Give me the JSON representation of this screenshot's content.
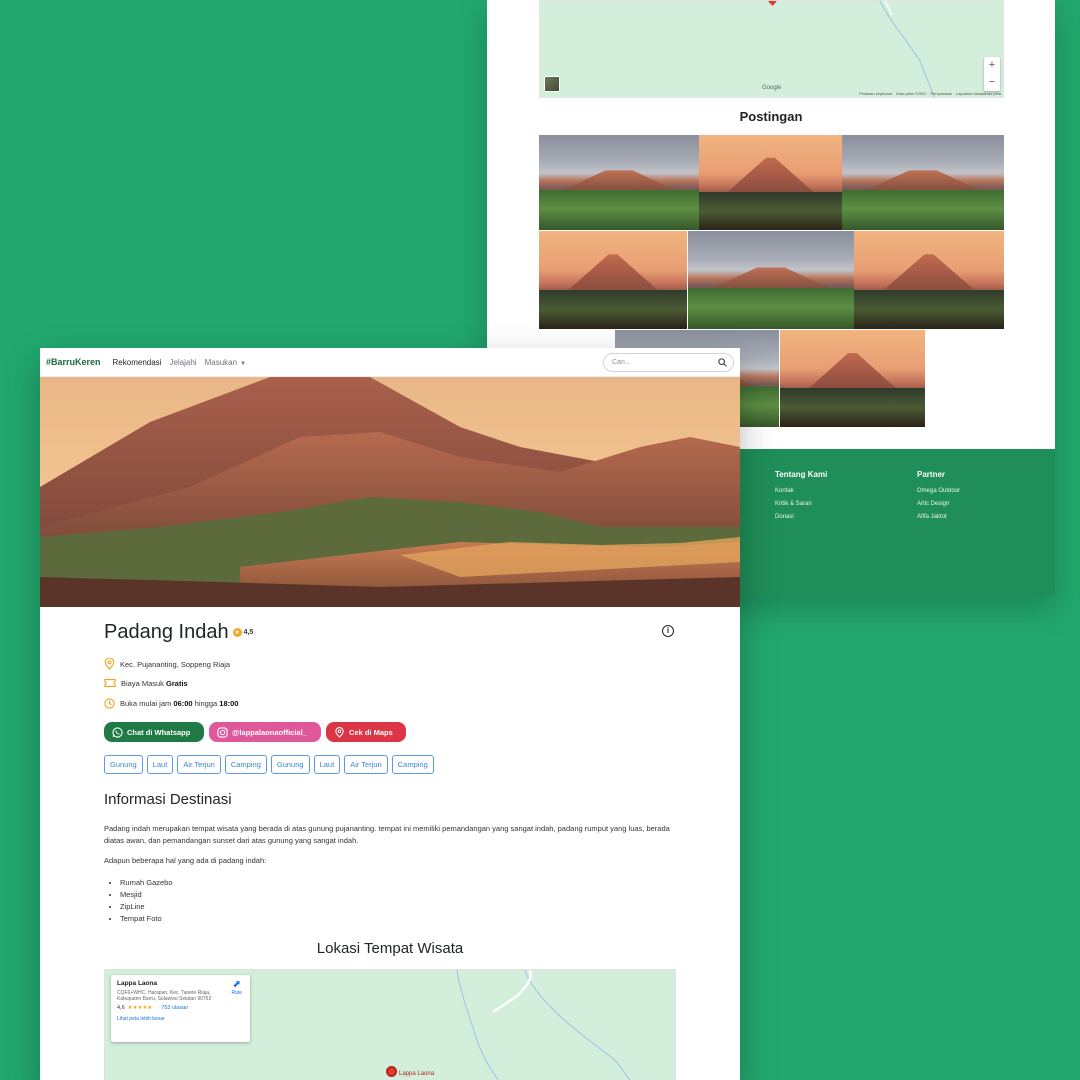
{
  "back": {
    "map": {
      "zoom_in": "+",
      "zoom_out": "−",
      "google": "Google",
      "attribution": [
        "Pintasan keyboard",
        "Data peta ©2022",
        "Persyaratan",
        "Laporkan kesalahan peta"
      ]
    },
    "posts_title": "Postingan",
    "footer": {
      "about_title": "Tentang Kami",
      "about_links": [
        "Kontak",
        "Kritik & Saran",
        "Donasi"
      ],
      "partner_title": "Partner",
      "partner_links": [
        "Omega Outdoor",
        "Artic Design",
        "Afifa Jaktot"
      ]
    }
  },
  "nav": {
    "brand": "#BarruKeren",
    "links": [
      "Rekomendasi",
      "Jelajahi",
      "Masukan"
    ],
    "search_placeholder": "Cari..."
  },
  "place": {
    "name": "Padang Indah",
    "rating": "4,5",
    "location": "Kec. Pujananting, Soppeng Riaja",
    "fee_label": "Biaya Masuk",
    "fee_value": "Gratis",
    "hours_label": "Buka mulai jam",
    "open": "06:00",
    "hours_mid": "hingga",
    "close": "18:00"
  },
  "buttons": {
    "whatsapp": "Chat di Whatsapp",
    "instagram": "@lappalaonaofficial_",
    "maps": "Cek di Maps"
  },
  "tags": [
    "Gunung",
    "Laut",
    "Air Terjun",
    "Camping",
    "Gunung",
    "Laut",
    "Air Terjun",
    "Camping"
  ],
  "info": {
    "heading": "Informasi Destinasi",
    "paragraph": "Padang indah merupakan tempat wisata yang berada di atas gunung pujananting. tempat ini memiliki pemandangan yang sangat indah, padang rumput yang luas, berada diatas awan, dan pemandangan sunset dari atas gunung yang sangat indah.",
    "list_intro": "Adapun beberapa hal yang ada di padang indah:",
    "items": [
      "Rumah Gazebo",
      "Mesjid",
      "ZipLine",
      "Tempat Foto"
    ]
  },
  "location": {
    "heading": "Lokasi Tempat Wisata",
    "card_name": "Lappa Laona",
    "card_address": "CQF6+WHC, Harapan, Kec. Tanete Riaja, Kabupaten Barru, Sulawesi Selatan 90762",
    "card_rating": "4,6",
    "card_stars": "★★★★★",
    "card_reviews": "753 ulasan",
    "card_route": "Rute",
    "card_link": "Lihat peta lebih besar",
    "pin_label": "Lappa Laona"
  }
}
